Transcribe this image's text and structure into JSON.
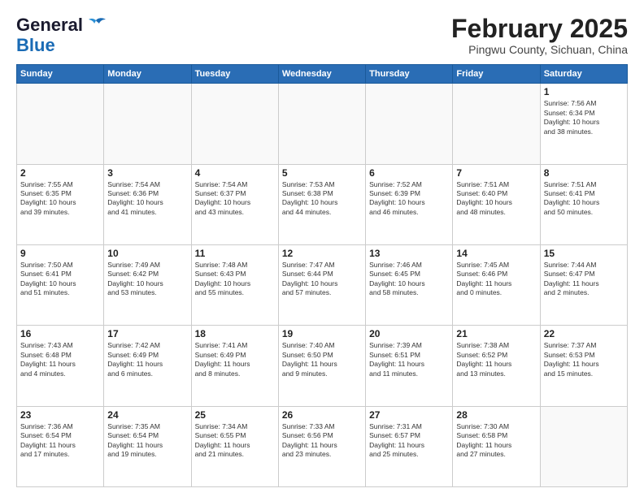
{
  "header": {
    "logo_general": "General",
    "logo_blue": "Blue",
    "month_title": "February 2025",
    "subtitle": "Pingwu County, Sichuan, China"
  },
  "weekdays": [
    "Sunday",
    "Monday",
    "Tuesday",
    "Wednesday",
    "Thursday",
    "Friday",
    "Saturday"
  ],
  "weeks": [
    [
      {
        "day": "",
        "info": ""
      },
      {
        "day": "",
        "info": ""
      },
      {
        "day": "",
        "info": ""
      },
      {
        "day": "",
        "info": ""
      },
      {
        "day": "",
        "info": ""
      },
      {
        "day": "",
        "info": ""
      },
      {
        "day": "1",
        "info": "Sunrise: 7:56 AM\nSunset: 6:34 PM\nDaylight: 10 hours\nand 38 minutes."
      }
    ],
    [
      {
        "day": "2",
        "info": "Sunrise: 7:55 AM\nSunset: 6:35 PM\nDaylight: 10 hours\nand 39 minutes."
      },
      {
        "day": "3",
        "info": "Sunrise: 7:54 AM\nSunset: 6:36 PM\nDaylight: 10 hours\nand 41 minutes."
      },
      {
        "day": "4",
        "info": "Sunrise: 7:54 AM\nSunset: 6:37 PM\nDaylight: 10 hours\nand 43 minutes."
      },
      {
        "day": "5",
        "info": "Sunrise: 7:53 AM\nSunset: 6:38 PM\nDaylight: 10 hours\nand 44 minutes."
      },
      {
        "day": "6",
        "info": "Sunrise: 7:52 AM\nSunset: 6:39 PM\nDaylight: 10 hours\nand 46 minutes."
      },
      {
        "day": "7",
        "info": "Sunrise: 7:51 AM\nSunset: 6:40 PM\nDaylight: 10 hours\nand 48 minutes."
      },
      {
        "day": "8",
        "info": "Sunrise: 7:51 AM\nSunset: 6:41 PM\nDaylight: 10 hours\nand 50 minutes."
      }
    ],
    [
      {
        "day": "9",
        "info": "Sunrise: 7:50 AM\nSunset: 6:41 PM\nDaylight: 10 hours\nand 51 minutes."
      },
      {
        "day": "10",
        "info": "Sunrise: 7:49 AM\nSunset: 6:42 PM\nDaylight: 10 hours\nand 53 minutes."
      },
      {
        "day": "11",
        "info": "Sunrise: 7:48 AM\nSunset: 6:43 PM\nDaylight: 10 hours\nand 55 minutes."
      },
      {
        "day": "12",
        "info": "Sunrise: 7:47 AM\nSunset: 6:44 PM\nDaylight: 10 hours\nand 57 minutes."
      },
      {
        "day": "13",
        "info": "Sunrise: 7:46 AM\nSunset: 6:45 PM\nDaylight: 10 hours\nand 58 minutes."
      },
      {
        "day": "14",
        "info": "Sunrise: 7:45 AM\nSunset: 6:46 PM\nDaylight: 11 hours\nand 0 minutes."
      },
      {
        "day": "15",
        "info": "Sunrise: 7:44 AM\nSunset: 6:47 PM\nDaylight: 11 hours\nand 2 minutes."
      }
    ],
    [
      {
        "day": "16",
        "info": "Sunrise: 7:43 AM\nSunset: 6:48 PM\nDaylight: 11 hours\nand 4 minutes."
      },
      {
        "day": "17",
        "info": "Sunrise: 7:42 AM\nSunset: 6:49 PM\nDaylight: 11 hours\nand 6 minutes."
      },
      {
        "day": "18",
        "info": "Sunrise: 7:41 AM\nSunset: 6:49 PM\nDaylight: 11 hours\nand 8 minutes."
      },
      {
        "day": "19",
        "info": "Sunrise: 7:40 AM\nSunset: 6:50 PM\nDaylight: 11 hours\nand 9 minutes."
      },
      {
        "day": "20",
        "info": "Sunrise: 7:39 AM\nSunset: 6:51 PM\nDaylight: 11 hours\nand 11 minutes."
      },
      {
        "day": "21",
        "info": "Sunrise: 7:38 AM\nSunset: 6:52 PM\nDaylight: 11 hours\nand 13 minutes."
      },
      {
        "day": "22",
        "info": "Sunrise: 7:37 AM\nSunset: 6:53 PM\nDaylight: 11 hours\nand 15 minutes."
      }
    ],
    [
      {
        "day": "23",
        "info": "Sunrise: 7:36 AM\nSunset: 6:54 PM\nDaylight: 11 hours\nand 17 minutes."
      },
      {
        "day": "24",
        "info": "Sunrise: 7:35 AM\nSunset: 6:54 PM\nDaylight: 11 hours\nand 19 minutes."
      },
      {
        "day": "25",
        "info": "Sunrise: 7:34 AM\nSunset: 6:55 PM\nDaylight: 11 hours\nand 21 minutes."
      },
      {
        "day": "26",
        "info": "Sunrise: 7:33 AM\nSunset: 6:56 PM\nDaylight: 11 hours\nand 23 minutes."
      },
      {
        "day": "27",
        "info": "Sunrise: 7:31 AM\nSunset: 6:57 PM\nDaylight: 11 hours\nand 25 minutes."
      },
      {
        "day": "28",
        "info": "Sunrise: 7:30 AM\nSunset: 6:58 PM\nDaylight: 11 hours\nand 27 minutes."
      },
      {
        "day": "",
        "info": ""
      }
    ]
  ]
}
